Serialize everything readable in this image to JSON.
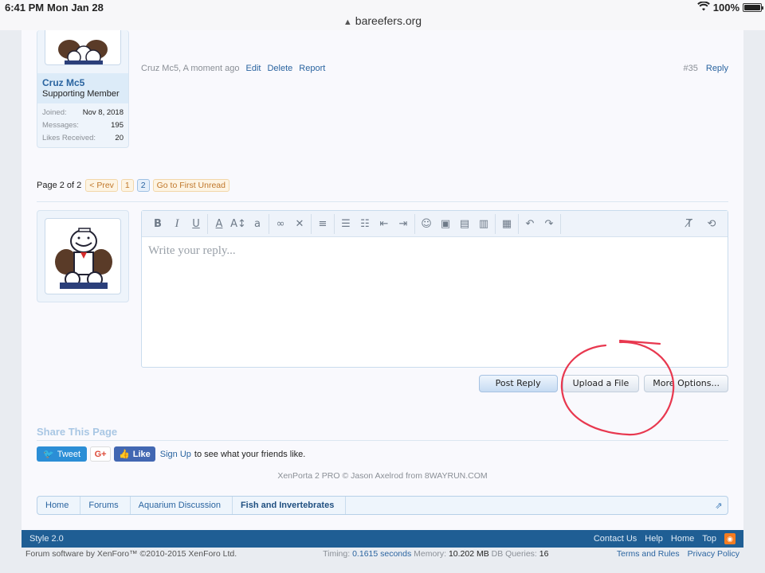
{
  "status_bar": {
    "time": "6:41 PM",
    "date": "Mon Jan 28",
    "url": "bareefers.org",
    "battery": "100%"
  },
  "message": {
    "username": "Cruz Mc5",
    "user_title": "Supporting Member",
    "stats": [
      {
        "label": "Joined:",
        "value": "Nov 8, 2018"
      },
      {
        "label": "Messages:",
        "value": "195"
      },
      {
        "label": "Likes Received:",
        "value": "20"
      }
    ],
    "meta": "Cruz Mc5, A moment ago",
    "edit": "Edit",
    "delete": "Delete",
    "report": "Report",
    "post_number": "#35",
    "reply": "Reply"
  },
  "page_nav": {
    "label": "Page 2 of 2",
    "prev": "< Prev",
    "page1": "1",
    "page2": "2",
    "first_unread": "Go to First Unread"
  },
  "editor": {
    "placeholder": "Write your reply..."
  },
  "buttons": {
    "post_reply": "Post Reply",
    "upload": "Upload a File",
    "more_options": "More Options..."
  },
  "share": {
    "title": "Share This Page",
    "tweet": "Tweet",
    "gplus": "G+",
    "like": "Like",
    "signup": "Sign Up",
    "signup_text": "to see what your friends like."
  },
  "copyright": "XenPorta 2 PRO © Jason Axelrod from 8WAYRUN.COM",
  "breadcrumb": [
    "Home",
    "Forums",
    "Aquarium Discussion",
    "Fish and Invertebrates"
  ],
  "footer": {
    "style": "Style 2.0",
    "contact": "Contact Us",
    "help": "Help",
    "home": "Home",
    "top": "Top"
  },
  "legal": {
    "software": "Forum software by XenForo™ ©2010-2015 XenForo Ltd.",
    "timing_label": "Timing:",
    "timing": "0.1615 seconds",
    "memory_label": "Memory:",
    "memory": "10.202 MB",
    "db_label": "DB Queries:",
    "db": "16",
    "terms": "Terms and Rules",
    "privacy": "Privacy Policy"
  },
  "colors": {
    "accent": "#2a64a0",
    "footer": "#1f5e94",
    "annotation": "#e8384f"
  }
}
